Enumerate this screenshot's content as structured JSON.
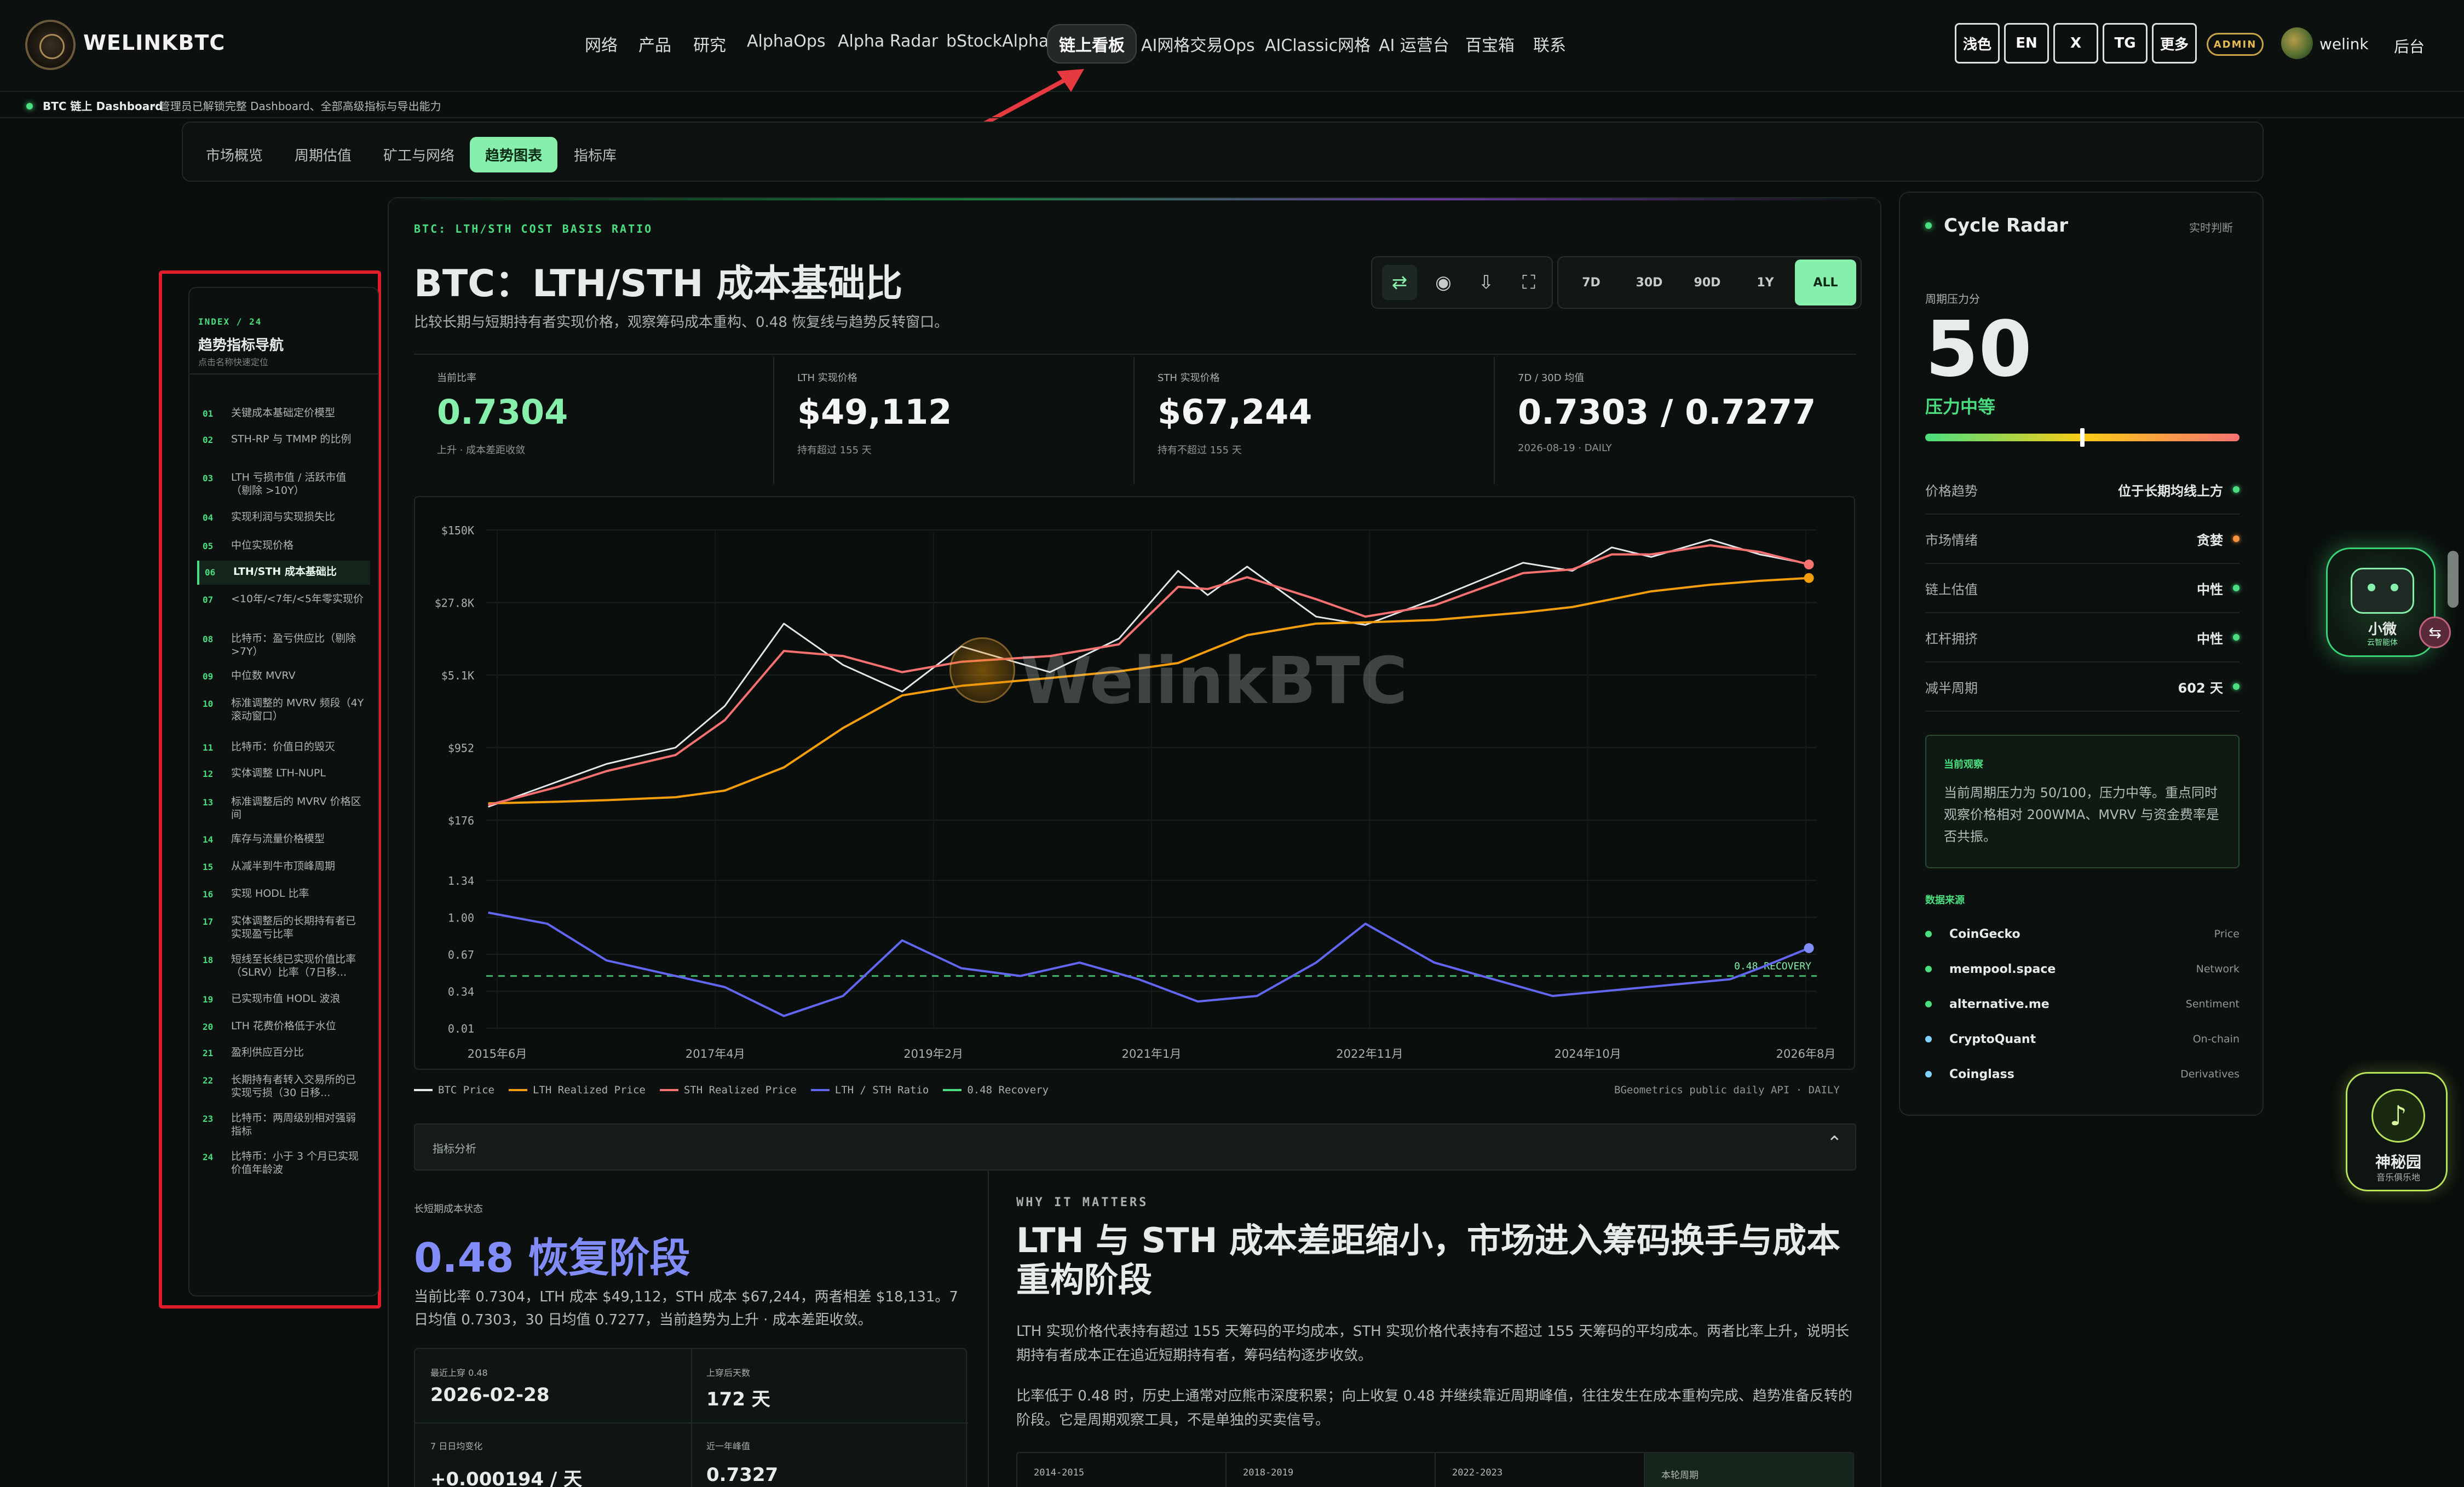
{
  "nav": {
    "brand": "WELINKBTC",
    "items": [
      "网络",
      "产品",
      "研究",
      "AlphaOps",
      "Alpha Radar",
      "bStockAlpha",
      "链上看板",
      "AI网格交易Ops",
      "AIClassic网格",
      "AI 运营台",
      "百宝箱",
      "联系"
    ],
    "active_index": 6,
    "buttons": [
      "浅色",
      "EN",
      "X",
      "TG",
      "更多"
    ],
    "admin_badge": "ADMIN",
    "user": "welink",
    "backend": "后台"
  },
  "subbar": {
    "title": "BTC 链上 Dashboard",
    "desc": "· 管理员已解锁完整 Dashboard、全部高级指标与导出能力"
  },
  "tabs": [
    "市场概览",
    "周期估值",
    "矿工与网络",
    "趋势图表",
    "指标库"
  ],
  "tabs_active": 3,
  "index_nav": {
    "eyebrow": "INDEX / 24",
    "title": "趋势指标导航",
    "subtitle": "点击名称快速定位",
    "active": 5,
    "items": [
      {
        "num": "01",
        "label": "关键成本基础定价模型"
      },
      {
        "num": "02",
        "label": "STH-RP 与 TMMP 的比例"
      },
      {
        "num": "03",
        "label": "LTH 亏损市值 / 活跃市值（剔除 >10Y）"
      },
      {
        "num": "04",
        "label": "实现利润与实现损失比"
      },
      {
        "num": "05",
        "label": "中位实现价格"
      },
      {
        "num": "06",
        "label": "LTH/STH 成本基础比"
      },
      {
        "num": "07",
        "label": "<10年/<7年/<5年零实现价"
      },
      {
        "num": "08",
        "label": "比特币：盈亏供应比（剔除 >7Y）"
      },
      {
        "num": "09",
        "label": "中位数 MVRV"
      },
      {
        "num": "10",
        "label": "标准调整的 MVRV 频段（4Y 滚动窗口）"
      },
      {
        "num": "11",
        "label": "比特币：价值日的毁灭"
      },
      {
        "num": "12",
        "label": "实体调整 LTH-NUPL"
      },
      {
        "num": "13",
        "label": "标准调整后的 MVRV 价格区间"
      },
      {
        "num": "14",
        "label": "库存与流量价格模型"
      },
      {
        "num": "15",
        "label": "从减半到牛市顶峰周期"
      },
      {
        "num": "16",
        "label": "实现 HODL 比率"
      },
      {
        "num": "17",
        "label": "实体调整后的长期持有者已实现盈亏比率"
      },
      {
        "num": "18",
        "label": "短线至长线已实现价值比率（SLRV）比率（7日移..."
      },
      {
        "num": "19",
        "label": "已实现市值 HODL 波浪"
      },
      {
        "num": "20",
        "label": "LTH 花费价格低于水位"
      },
      {
        "num": "21",
        "label": "盈利供应百分比"
      },
      {
        "num": "22",
        "label": "长期持有者转入交易所的已实现亏损（30 日移..."
      },
      {
        "num": "23",
        "label": "比特币：两周级别相对强弱指标"
      },
      {
        "num": "24",
        "label": "比特币：小于 3 个月已实现价值年龄波"
      }
    ]
  },
  "main": {
    "eyebrow": "BTC: LTH/STH COST BASIS RATIO",
    "title": "BTC：LTH/STH 成本基础比",
    "subtitle": "比较长期与短期持有者实现价格，观察筹码成本重构、0.48 恢复线与趋势反转窗口。",
    "ranges": [
      "7D",
      "30D",
      "90D",
      "1Y",
      "ALL"
    ],
    "range_active": 4,
    "icons": [
      "swap-icon",
      "record-icon",
      "download-icon",
      "fullscreen-icon"
    ],
    "kpis": [
      {
        "label": "当前比率",
        "value": "0.7304",
        "sub": "上升 · 成本差距收敛",
        "green": true
      },
      {
        "label": "LTH 实现价格",
        "value": "$49,112",
        "sub": "持有超过 155 天"
      },
      {
        "label": "STH 实现价格",
        "value": "$67,244",
        "sub": "持有不超过 155 天"
      },
      {
        "label": "7D / 30D 均值",
        "value": "0.7303 / 0.7277",
        "sub": "2026-08-19 · DAILY"
      }
    ],
    "watermark": "WelinkBTC",
    "legend": [
      "BTC Price",
      "LTH Realized Price",
      "STH Realized Price",
      "LTH / STH Ratio",
      "0.48 Recovery"
    ],
    "source_note": "BGeometrics public daily API · DAILY",
    "analysis_bar": "指标分析",
    "state": {
      "eyebrow": "长短期成本状态",
      "headline": "0.48 恢复阶段",
      "desc": "当前比率 0.7304，LTH 成本 $49,112，STH 成本 $67,244，两者相差 $18,131。7 日均值 0.7303，30 日均值 0.7277，当前趋势为上升 · 成本差距收敛。",
      "cards": [
        {
          "label": "最近上穿 0.48",
          "value": "2026-02-28"
        },
        {
          "label": "上穿后天数",
          "value": "172 天"
        },
        {
          "label": "7 日日均变化",
          "value": "+0.000194 / 天"
        },
        {
          "label": "近一年峰值",
          "value": "0.7327"
        }
      ]
    },
    "why": {
      "eyebrow": "WHY IT MATTERS",
      "title": "LTH 与 STH 成本差距缩小，市场进入筹码换手与成本重构阶段",
      "p1": "LTH 实现价格代表持有超过 155 天筹码的平均成本，STH 实现价格代表持有不超过 155 天筹码的平均成本。两者比率上升，说明长期持有者成本正在追近短期持有者，筹码结构逐步收敛。",
      "p2": "比率低于 0.48 时，历史上通常对应熊市深度积累；向上收复 0.48 并继续靠近周期峰值，往往发生在成本重构完成、趋势准备反转的阶段。它是周期观察工具，不是单独的买卖信号。",
      "periods": [
        "2014-2015",
        "2018-2019",
        "2022-2023",
        "本轮周期"
      ]
    }
  },
  "chart_data": [
    {
      "type": "line",
      "title": "",
      "y_scale": "log",
      "y_ticks": [
        "$150K",
        "$27.8K",
        "$5.1K",
        "$952",
        "$176"
      ],
      "x_ticks": [
        "2015年6月",
        "2017年4月",
        "2019年2月",
        "2021年1月",
        "2022年11月",
        "2024年10月",
        "2026年8月"
      ],
      "series": [
        {
          "name": "BTC Price",
          "color": "#e5e7eb",
          "x": [
            "2015-06",
            "2016-01",
            "2016-06",
            "2017-01",
            "2017-06",
            "2017-12",
            "2018-06",
            "2018-12",
            "2019-06",
            "2020-03",
            "2020-10",
            "2021-04",
            "2021-07",
            "2021-11",
            "2022-06",
            "2022-11",
            "2023-06",
            "2024-03",
            "2024-08",
            "2024-12",
            "2025-04",
            "2025-10",
            "2026-03",
            "2026-08"
          ],
          "values": [
            240,
            430,
            650,
            950,
            2500,
            17000,
            6500,
            3500,
            10000,
            5500,
            12000,
            58000,
            33000,
            64000,
            20000,
            16500,
            30000,
            70000,
            58000,
            100000,
            80000,
            120000,
            85000,
            68000
          ]
        },
        {
          "name": "LTH Realized Price",
          "color": "#f59e0b",
          "x": [
            "2015-06",
            "2016-01",
            "2016-06",
            "2017-01",
            "2017-06",
            "2017-12",
            "2018-06",
            "2018-12",
            "2019-06",
            "2020-03",
            "2020-10",
            "2021-04",
            "2021-07",
            "2021-11",
            "2022-06",
            "2022-11",
            "2023-06",
            "2024-03",
            "2024-08",
            "2024-12",
            "2025-04",
            "2025-10",
            "2026-03",
            "2026-08"
          ],
          "values": [
            260,
            270,
            280,
            300,
            350,
            600,
            1500,
            3200,
            4000,
            4800,
            5600,
            6800,
            9000,
            13000,
            17000,
            17500,
            18500,
            22000,
            25000,
            30000,
            36000,
            42000,
            46000,
            49112
          ]
        },
        {
          "name": "STH Realized Price",
          "color": "#f87171",
          "x": [
            "2015-06",
            "2016-01",
            "2016-06",
            "2017-01",
            "2017-06",
            "2017-12",
            "2018-06",
            "2018-12",
            "2019-06",
            "2020-03",
            "2020-10",
            "2021-04",
            "2021-07",
            "2021-11",
            "2022-06",
            "2022-11",
            "2023-06",
            "2024-03",
            "2024-08",
            "2024-12",
            "2025-04",
            "2025-10",
            "2026-03",
            "2026-08"
          ],
          "values": [
            250,
            380,
            550,
            800,
            1800,
            9000,
            8000,
            5500,
            7000,
            8000,
            10500,
            40000,
            38000,
            50000,
            30000,
            20000,
            26000,
            55000,
            60000,
            85000,
            85000,
            105000,
            90000,
            67244
          ]
        }
      ]
    },
    {
      "type": "line",
      "title": "",
      "y_ticks": [
        "1.34",
        "1.00",
        "0.67",
        "0.34",
        "0.01"
      ],
      "y_range": [
        0.01,
        1.34
      ],
      "reference_line": {
        "label": "0.48 RECOVERY",
        "value": 0.48
      },
      "series": [
        {
          "name": "LTH / STH Ratio",
          "color": "#6366f1",
          "x": [
            "2015-06",
            "2015-12",
            "2016-06",
            "2016-12",
            "2017-06",
            "2017-12",
            "2018-06",
            "2018-12",
            "2019-06",
            "2019-12",
            "2020-06",
            "2020-12",
            "2021-06",
            "2021-12",
            "2022-06",
            "2022-11",
            "2023-06",
            "2023-12",
            "2024-06",
            "2024-12",
            "2025-06",
            "2025-12",
            "2026-03",
            "2026-08"
          ],
          "values": [
            1.05,
            0.95,
            0.62,
            0.5,
            0.38,
            0.12,
            0.3,
            0.8,
            0.55,
            0.48,
            0.6,
            0.45,
            0.25,
            0.3,
            0.6,
            0.95,
            0.6,
            0.45,
            0.3,
            0.35,
            0.4,
            0.45,
            0.55,
            0.7304
          ]
        }
      ]
    }
  ],
  "radar": {
    "title": "Cycle Radar",
    "badge": "实时判断",
    "score_label": "周期压力分",
    "score": "50",
    "level": "压力中等",
    "score_fraction": 0.5,
    "rows": [
      {
        "label": "价格趋势",
        "value": "位于长期均线上方",
        "color": "#4ade80"
      },
      {
        "label": "市场情绪",
        "value": "贪婪",
        "color": "#fb923c"
      },
      {
        "label": "链上估值",
        "value": "中性",
        "color": "#4ade80"
      },
      {
        "label": "杠杆拥挤",
        "value": "中性",
        "color": "#4ade80"
      },
      {
        "label": "减半周期",
        "value": "602 天",
        "color": "#4ade80"
      }
    ],
    "obs_title": "当前观察",
    "obs_text": "当前周期压力为 50/100，压力中等。重点同时观察价格相对 200WMA、MVRV 与资金费率是否共振。",
    "sources_title": "数据来源",
    "sources": [
      {
        "name": "CoinGecko",
        "type": "Price",
        "color": "#4ade80"
      },
      {
        "name": "mempool.space",
        "type": "Network",
        "color": "#4ade80"
      },
      {
        "name": "alternative.me",
        "type": "Sentiment",
        "color": "#4ade80"
      },
      {
        "name": "CryptoQuant",
        "type": "On-chain",
        "color": "#7dd3fc"
      },
      {
        "name": "Coinglass",
        "type": "Derivatives",
        "color": "#7dd3fc"
      }
    ]
  },
  "float": {
    "bot_label": "小微",
    "bot_sub": "云智能体",
    "garden_label": "神秘园",
    "garden_sub": "音乐俱乐地"
  }
}
